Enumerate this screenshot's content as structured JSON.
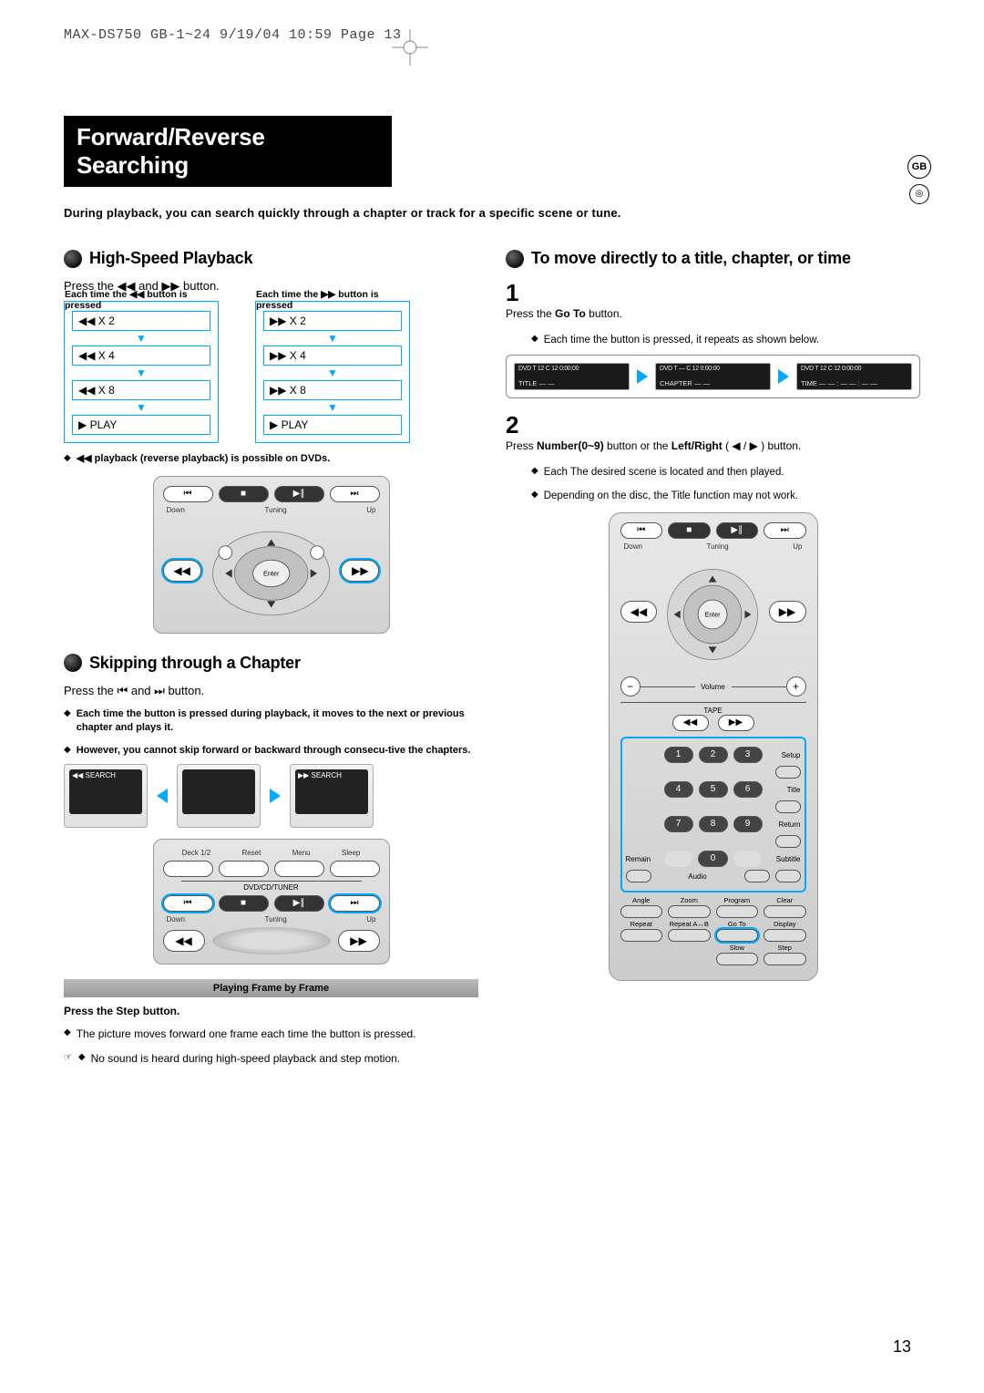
{
  "header": "MAX-DS750 GB-1~24  9/19/04 10:59  Page 13",
  "sideTab": {
    "gb": "GB",
    "disc": "◎"
  },
  "title": "Forward/Reverse Searching",
  "intro": "During playback, you can search quickly through a chapter or track for a specific scene or tune.",
  "left": {
    "section1": {
      "heading": "High-Speed Playback",
      "press": "Press the  ◀◀  and  ▶▶  button.",
      "colHdrL": "Each time the ◀◀ button is pressed",
      "colHdrR": "Each time the ▶▶ button is pressed",
      "speedsL": [
        "◀◀  X 2",
        "◀◀  X 4",
        "◀◀  X 8",
        "▶  PLAY"
      ],
      "speedsR": [
        "▶▶  X 2",
        "▶▶  X 4",
        "▶▶  X 8",
        "▶  PLAY"
      ],
      "note": "◀◀ playback (reverse playback) is possible on DVDs."
    },
    "remoteTop": {
      "row": [
        "⏮",
        "■",
        "▶∥",
        "⏭"
      ],
      "lbls": [
        "Down",
        "Tuning",
        "Up"
      ],
      "enter": "Enter"
    },
    "section2": {
      "heading": "Skipping through a Chapter",
      "press": "Press the  ⏮  and  ⏭  button.",
      "bullets": [
        "Each time the button is pressed during playback, it moves to the next or previous chapter and plays it.",
        "However, you cannot skip forward or backward through consecu-tive the chapters."
      ],
      "searchL": "◀◀ SEARCH",
      "searchR": "▶▶ SEARCH"
    },
    "remoteBot": {
      "topLbls": [
        "Deck 1/2",
        "Reset",
        "Menu",
        "Sleep"
      ],
      "dvd": "DVD/CD/TUNER"
    },
    "frameBar": "Playing Frame by Frame",
    "stepLine": "Press the Step button.",
    "stepNote": "The picture moves forward one frame each time the button is pressed.",
    "handNote": "No sound is heard during high-speed playback and step motion."
  },
  "right": {
    "heading": "To move directly to a title, chapter, or time",
    "step1": {
      "num": "1",
      "text_a": "Press the ",
      "text_goto": "Go To",
      "text_b": " button.",
      "sub": "Each time the button is pressed, it repeats as shown below.",
      "osd": [
        {
          "top": "DVD   T 12   C 12   0:00:00",
          "bot": "TITLE — —"
        },
        {
          "top": "DVD   T —   C 12   0:00:00",
          "bot": "CHAPTER — —"
        },
        {
          "top": "DVD   T 12   C 12   0:00:00",
          "bot": "TIME — — : — — : — —"
        }
      ]
    },
    "step2": {
      "num": "2",
      "text_a": "Press ",
      "text_num": "Number(0~9)",
      "text_b": " button or the ",
      "text_lr": "Left/Right",
      "text_c": " ( ◀ / ▶ ) button.",
      "bullets": [
        "Each The desired scene is located and then played.",
        "Depending on the disc, the Title function may not work."
      ]
    },
    "remote": {
      "row": [
        "⏮",
        "■",
        "▶∥",
        "⏭"
      ],
      "lbls": [
        "Down",
        "Tuning",
        "Up"
      ],
      "enter": "Enter",
      "vol": "Volume",
      "tape": "TAPE",
      "numRows": [
        {
          "l": "",
          "btns": [
            "1",
            "2",
            "3"
          ],
          "r": "Setup"
        },
        {
          "l": "",
          "btns": [
            "4",
            "5",
            "6"
          ],
          "r": "Title"
        },
        {
          "l": "",
          "btns": [
            "7",
            "8",
            "9"
          ],
          "r": "Return"
        },
        {
          "l": "Remain",
          "btns": [
            "",
            "0",
            ""
          ],
          "r": "Subtitle",
          "mid": "Audio"
        }
      ],
      "fn": [
        [
          "Angle",
          "Zoom",
          "Program",
          "Clear"
        ],
        [
          "Repeat",
          "Repeat A↔B",
          "Go To",
          "Display"
        ],
        [
          "",
          "",
          "Slow",
          "Step"
        ]
      ]
    }
  },
  "pageNum": "13"
}
